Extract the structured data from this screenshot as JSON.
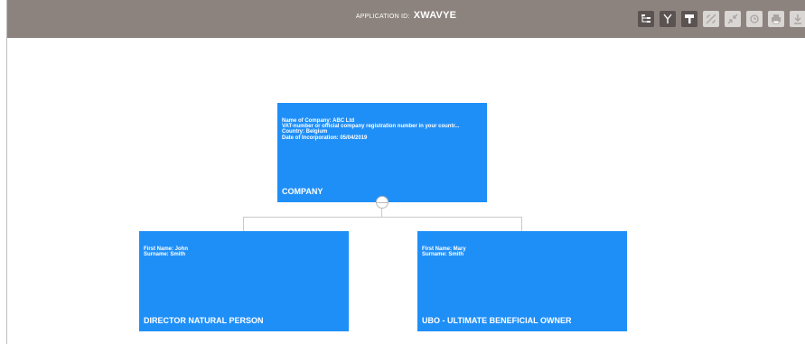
{
  "header": {
    "app_id_label": "APPLICATION ID:",
    "app_id_value": "XWAVYE"
  },
  "toolbar": [
    {
      "icon": "tree-layout-icon",
      "state": "active"
    },
    {
      "icon": "fork-icon",
      "state": "active"
    },
    {
      "icon": "format-painter-icon",
      "state": "active"
    },
    {
      "icon": "unlink-icon",
      "state": "disabled"
    },
    {
      "icon": "collapse-icon",
      "state": "disabled"
    },
    {
      "icon": "reset-icon",
      "state": "disabled"
    },
    {
      "icon": "print-icon",
      "state": "disabled"
    },
    {
      "icon": "download-icon",
      "state": "disabled"
    }
  ],
  "nodes": {
    "company": {
      "lines": [
        "Name of Company: ABC Ltd",
        "VAT-number or official company registration number in your countr...",
        "Country: Belgium",
        "Date of Incorporation: 05/04/2019"
      ],
      "title": "COMPANY"
    },
    "director": {
      "lines": [
        "First Name: John",
        "Surname: Smith"
      ],
      "title": "DIRECTOR NATURAL PERSON"
    },
    "ubo": {
      "lines": [
        "First Name: Mary",
        "Surname: Smith"
      ],
      "title": "UBO - ULTIMATE BENEFICIAL OWNER"
    }
  },
  "colors": {
    "header": "#8c837e",
    "node": "#1f8ff8",
    "connector": "#c9c9c9"
  }
}
